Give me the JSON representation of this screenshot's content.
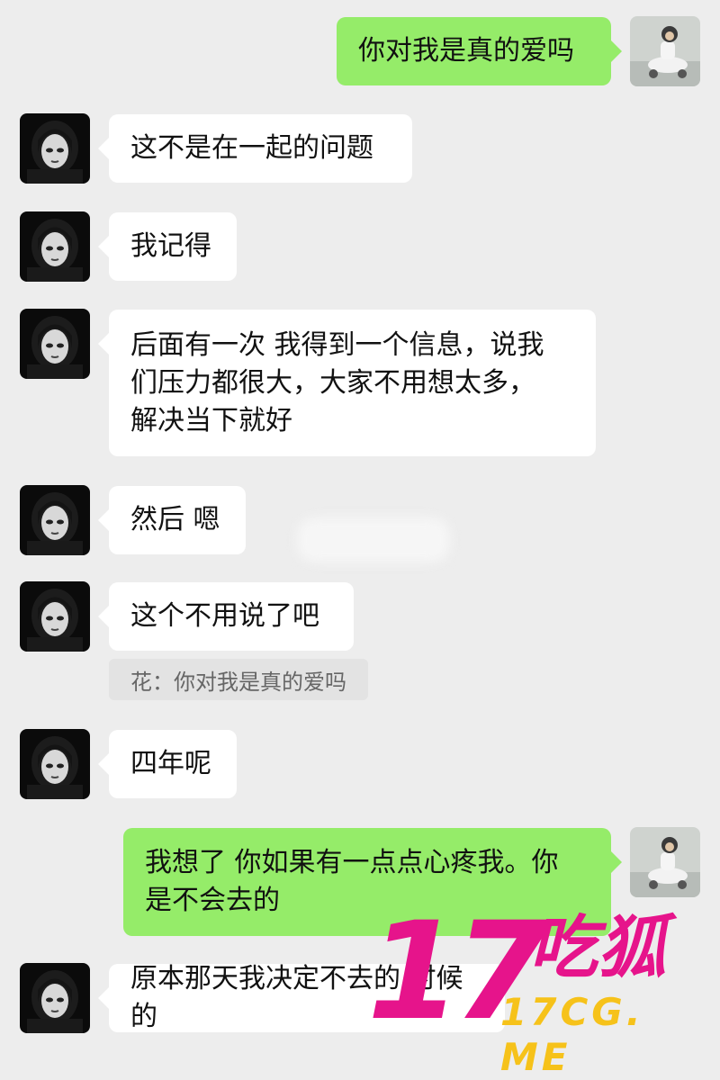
{
  "messages": [
    {
      "id": "m1",
      "side": "out",
      "text": "你对我是真的爱吗"
    },
    {
      "id": "m2",
      "side": "in",
      "text": "这不是在一起的问题"
    },
    {
      "id": "m3",
      "side": "in",
      "text": "我记得"
    },
    {
      "id": "m4",
      "side": "in",
      "text": "后面有一次 我得到一个信息，说我\n们压力都很大，大家不用想太多，\n解决当下就好"
    },
    {
      "id": "m5",
      "side": "in",
      "text": "然后 嗯"
    },
    {
      "id": "m6",
      "side": "in",
      "text": "这个不用说了吧",
      "quote": "花：你对我是真的爱吗"
    },
    {
      "id": "m7",
      "side": "in",
      "text": "四年呢"
    },
    {
      "id": "m8",
      "side": "out",
      "text": "我想了 你如果有一点点心疼我。你\n是不会去的"
    },
    {
      "id": "m9",
      "side": "in",
      "text": "原本那天我决定不去的 时候的"
    }
  ],
  "watermark": {
    "numeral": "17",
    "brand": "吃狐",
    "site": "17CG. ME",
    "color": "#e6148b",
    "site_color": "#f6c21a"
  },
  "colors": {
    "bg": "#ededed",
    "in_bubble": "#ffffff",
    "out_bubble": "#95ec69"
  }
}
